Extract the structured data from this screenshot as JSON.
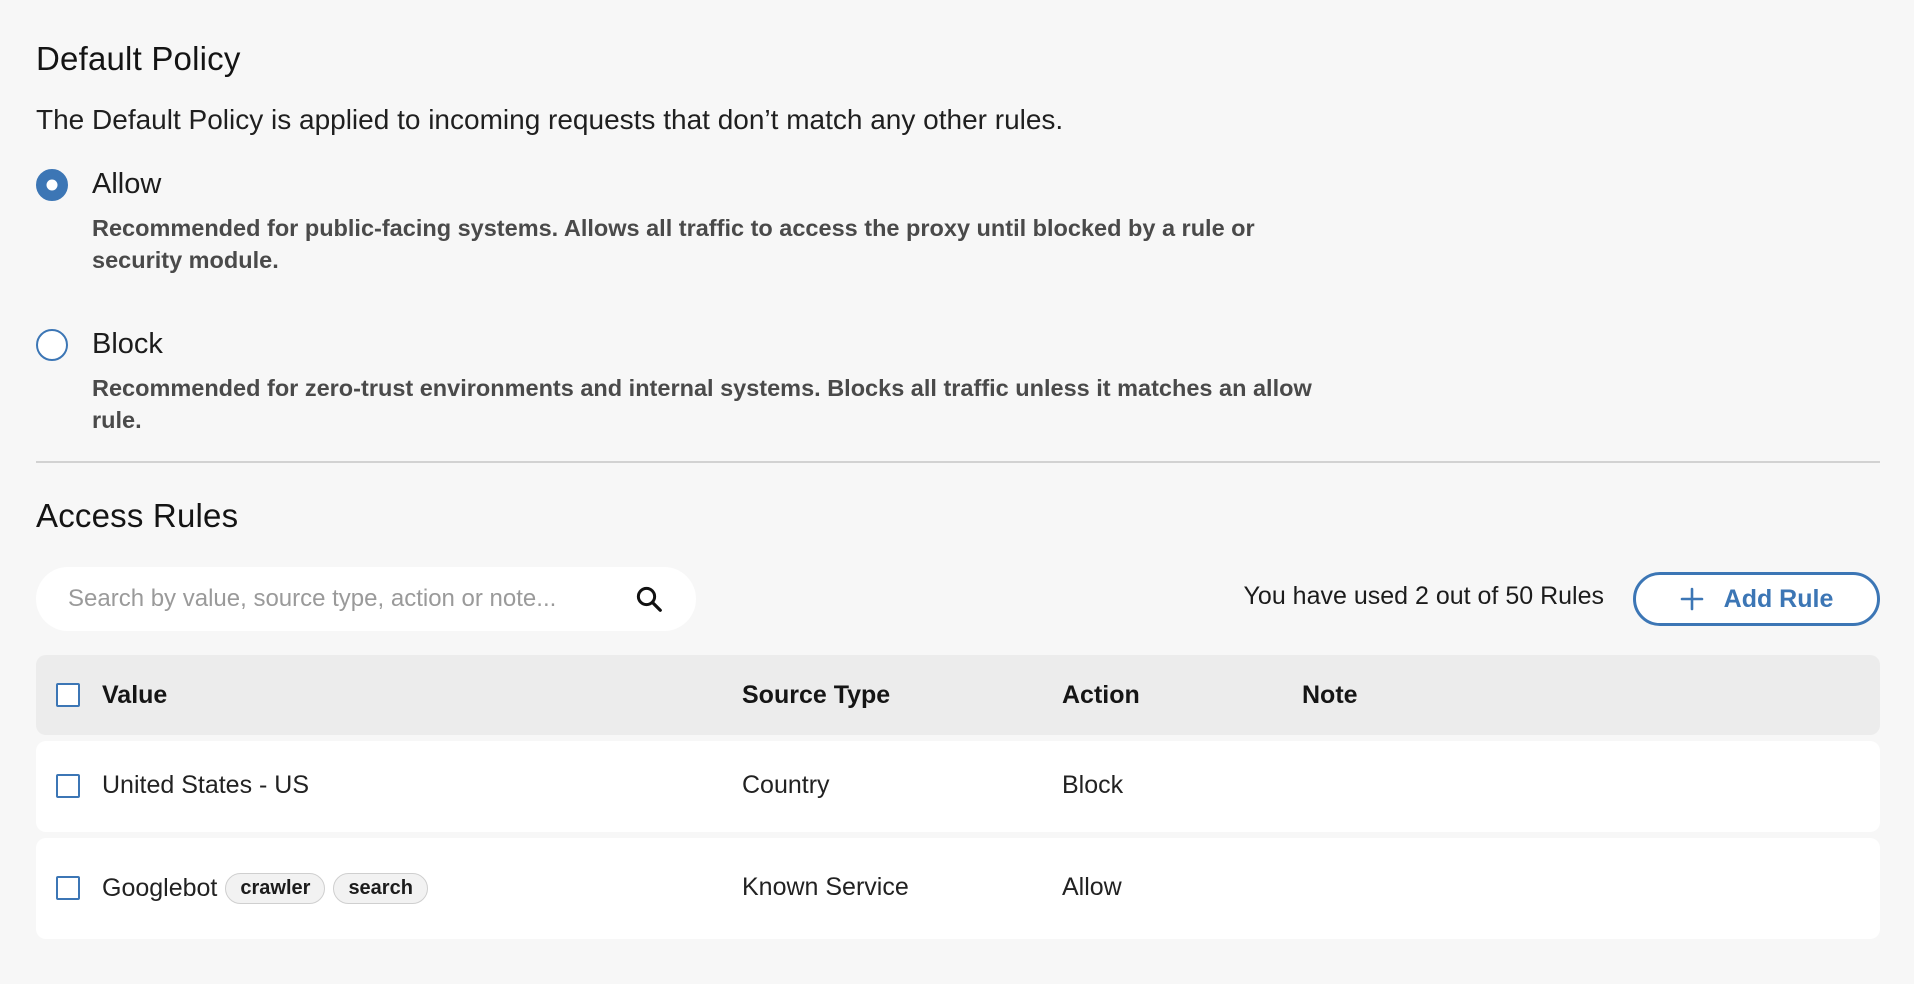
{
  "default_policy": {
    "title": "Default Policy",
    "description": "The Default Policy is applied to incoming requests that don’t match any other rules.",
    "selected": "allow",
    "options": [
      {
        "id": "allow",
        "label": "Allow",
        "description": "Recommended for public-facing systems. Allows all traffic to access the proxy until blocked by a rule or security module."
      },
      {
        "id": "block",
        "label": "Block",
        "description": "Recommended for zero-trust environments and internal systems. Blocks all traffic unless it matches an allow rule."
      }
    ]
  },
  "access_rules": {
    "title": "Access Rules",
    "search": {
      "placeholder": "Search by value, source type, action or note...",
      "value": ""
    },
    "usage_text": "You have used 2 out of 50 Rules",
    "add_button_label": "Add Rule",
    "columns": {
      "value": "Value",
      "source_type": "Source Type",
      "action": "Action",
      "note": "Note"
    },
    "rows": [
      {
        "value": "United States - US",
        "tags": [],
        "source_type": "Country",
        "action": "Block",
        "note": ""
      },
      {
        "value": "Googlebot",
        "tags": [
          "crawler",
          "search"
        ],
        "source_type": "Known Service",
        "action": "Allow",
        "note": ""
      }
    ]
  },
  "colors": {
    "accent": "#3c76b5",
    "background": "#f7f7f7",
    "row_background": "#ffffff",
    "header_background": "#ececec"
  },
  "icons": {
    "search": "search-icon",
    "add": "plus-icon"
  }
}
